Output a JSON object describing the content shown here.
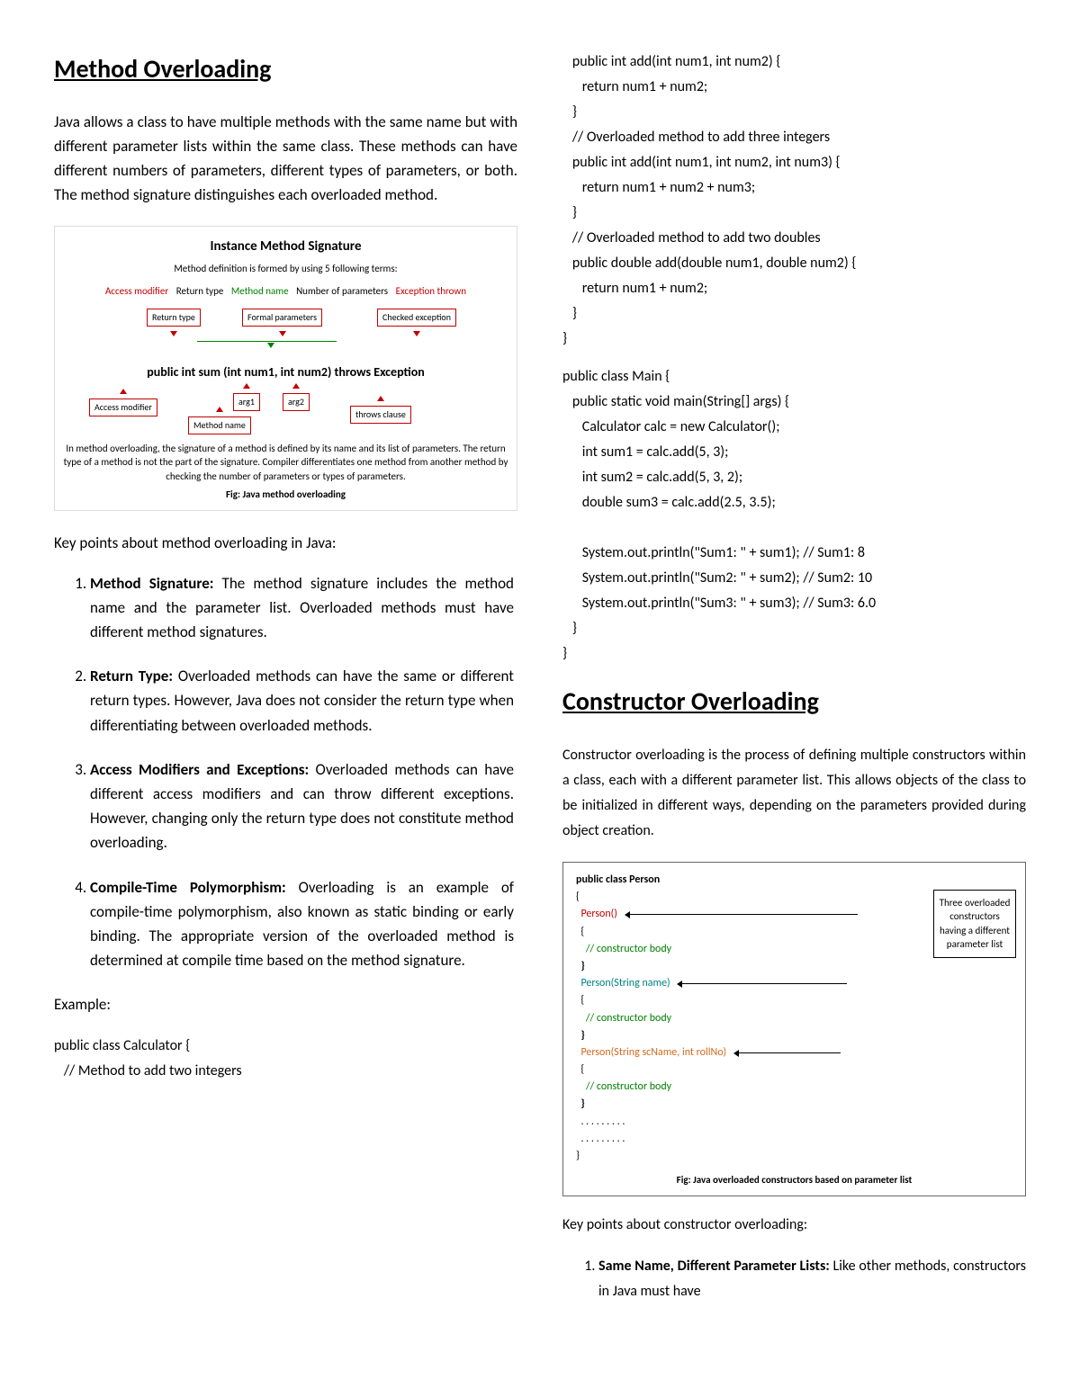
{
  "left": {
    "h1": "Method Overloading",
    "intro": "Java allows a class to have multiple methods with the same name but with different parameter lists within the same class. These methods can have different numbers of parameters, different types of parameters, or both. The method signature distinguishes each overloaded method.",
    "diagram": {
      "title": "Instance Method Signature",
      "subtitle": "Method definition is formed by using 5 following terms:",
      "legend": {
        "access": "Access modifier",
        "return": "Return type",
        "name": "Method name",
        "params": "Number of parameters",
        "exception": "Exception thrown"
      },
      "boxes": {
        "return_type": "Return type",
        "formal_params": "Formal parameters",
        "checked_exc": "Checked exception",
        "access_mod": "Access modifier",
        "arg1": "arg1",
        "arg2": "arg2",
        "method_name": "Method name",
        "throws_clause": "throws clause"
      },
      "sig": "public  int  sum (int num1, int num2) throws  Exception",
      "caption": "In method overloading, the signature of a method is defined by its name and its list of parameters. The return type of a method is not the part of the signature. Compiler differentiates one method from another method by checking the number of parameters or types of parameters.",
      "fig": "Fig: Java method overloading"
    },
    "keypoints_intro": "Key points about method overloading in Java:",
    "keypoints": [
      {
        "t": "Method Signature:",
        "d": " The method signature includes the method name and the parameter list. Overloaded methods must have different method signatures."
      },
      {
        "t": "Return Type:",
        "d": " Overloaded methods can have the same or different return types. However, Java does not consider the return type when differentiating between overloaded methods."
      },
      {
        "t": "Access Modifiers and Exceptions:",
        "d": " Overloaded methods can have different access modifiers and can throw different exceptions. However, changing only the return type does not constitute method overloading."
      },
      {
        "t": "Compile-Time Polymorphism:",
        "d": " Overloading is an example of compile-time polymorphism, also known as static binding or early binding. The appropriate version of the overloaded method is determined at compile time based on the method signature."
      }
    ],
    "example_label": "Example:",
    "code_start": "public class Calculator {\n   // Method to add two integers"
  },
  "right": {
    "code1": "   public int add(int num1, int num2) {\n      return num1 + num2;\n   }\n   // Overloaded method to add three integers\n   public int add(int num1, int num2, int num3) {\n      return num1 + num2 + num3;\n   }\n   // Overloaded method to add two doubles\n   public double add(double num1, double num2) {\n      return num1 + num2;\n   }\n}",
    "code2": "public class Main {\n   public static void main(String[] args) {\n      Calculator calc = new Calculator();\n      int sum1 = calc.add(5, 3);\n      int sum2 = calc.add(5, 3, 2);\n      double sum3 = calc.add(2.5, 3.5);\n\n      System.out.println(\"Sum1: \" + sum1); // Sum1: 8\n      System.out.println(\"Sum2: \" + sum2); // Sum2: 10\n      System.out.println(\"Sum3: \" + sum3); // Sum3: 6.0\n   }\n}",
    "h1": "Constructor Overloading",
    "intro": "Constructor overloading is the process of defining multiple constructors within a class, each with a different parameter list. This allows objects of the class to be initialized in different ways, depending on the parameters provided during object creation.",
    "ctor_diagram": {
      "class_decl": "public class Person",
      "c1": "Person()",
      "c2": "Person(String name)",
      "c3": "Person(String scName, int rollNo)",
      "body": "// constructor body",
      "dots": ". . . . . . . . .",
      "side": "Three overloaded constructors having a different parameter list",
      "fig": "Fig: Java overloaded constructors based on parameter list"
    },
    "keypoints_intro": "Key points about constructor overloading:",
    "keypoints": [
      {
        "t": "Same Name, Different Parameter Lists:",
        "d": " Like other methods, constructors in Java must have"
      }
    ]
  }
}
